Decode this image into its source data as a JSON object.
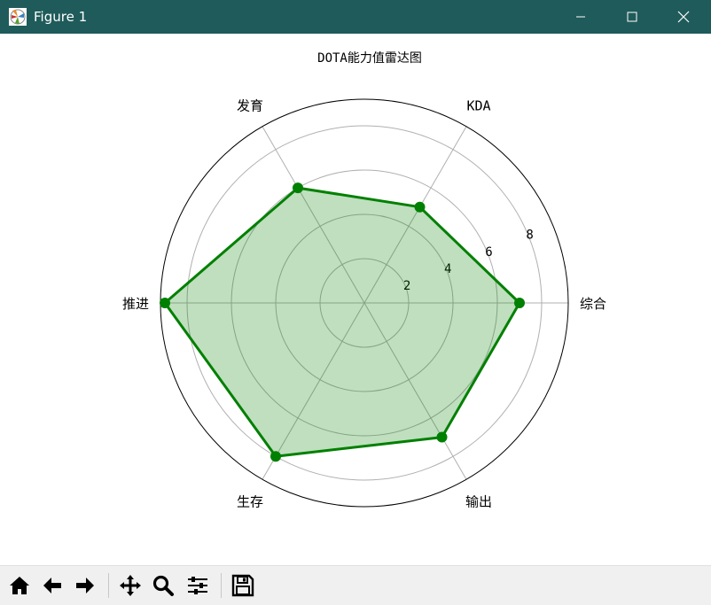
{
  "window": {
    "title": "Figure 1",
    "icon": "matplotlib-icon",
    "controls": [
      "minimize-icon",
      "maximize-icon",
      "close-icon"
    ],
    "titlebar_color": "#1f5b5a"
  },
  "toolbar": {
    "buttons": [
      {
        "name": "home-button",
        "icon": "home-icon"
      },
      {
        "name": "back-button",
        "icon": "arrow-left-icon"
      },
      {
        "name": "forward-button",
        "icon": "arrow-right-icon"
      },
      {
        "name": "pan-button",
        "icon": "move-icon"
      },
      {
        "name": "zoom-button",
        "icon": "magnifier-icon"
      },
      {
        "name": "configure-button",
        "icon": "sliders-icon"
      },
      {
        "name": "save-button",
        "icon": "floppy-disk-icon"
      }
    ]
  },
  "chart_data": {
    "type": "radar",
    "title": "DOTA能力值雷达图",
    "categories": [
      "综合",
      "KDA",
      "发育",
      "推进",
      "生存",
      "输出"
    ],
    "values": [
      7,
      5,
      6,
      9,
      8,
      7
    ],
    "rlim": [
      0,
      9.2
    ],
    "radial_ticks": [
      2,
      4,
      6,
      8
    ],
    "radial_tick_labels": [
      "2",
      "4",
      "6",
      "8"
    ],
    "grid": true,
    "line_color": "#008000",
    "fill_color": "#008000",
    "fill_alpha": 0.25
  }
}
